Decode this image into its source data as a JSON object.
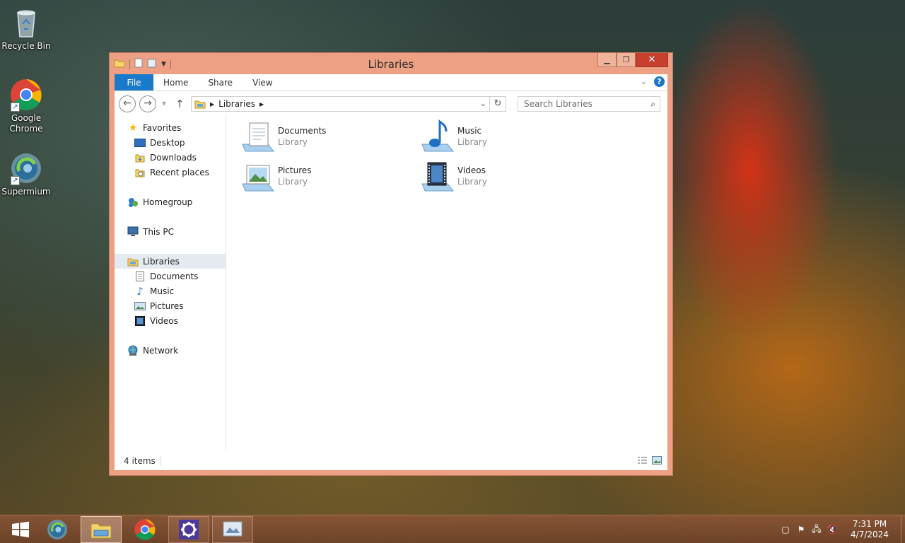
{
  "desktop": {
    "icons": [
      {
        "label": "Recycle Bin",
        "icon": "recycle-bin-icon"
      },
      {
        "label": "Google Chrome",
        "label_line1": "Google",
        "label_line2": "Chrome",
        "icon": "chrome-icon"
      },
      {
        "label": "Supermium",
        "icon": "supermium-icon"
      }
    ]
  },
  "window": {
    "title": "Libraries",
    "ribbon_tabs": [
      "File",
      "Home",
      "Share",
      "View"
    ],
    "help_label": "?",
    "address": {
      "segments": [
        "Libraries"
      ]
    },
    "search_placeholder": "Search Libraries",
    "nav_pane": {
      "favorites": {
        "label": "Favorites",
        "items": [
          "Desktop",
          "Downloads",
          "Recent places"
        ]
      },
      "homegroup": "Homegroup",
      "this_pc": "This PC",
      "libraries": {
        "label": "Libraries",
        "items": [
          "Documents",
          "Music",
          "Pictures",
          "Videos"
        ]
      },
      "network": "Network"
    },
    "content": {
      "items": [
        {
          "name": "Documents",
          "type": "Library",
          "icon": "documents-library-icon"
        },
        {
          "name": "Music",
          "type": "Library",
          "icon": "music-library-icon"
        },
        {
          "name": "Pictures",
          "type": "Library",
          "icon": "pictures-library-icon"
        },
        {
          "name": "Videos",
          "type": "Library",
          "icon": "videos-library-icon"
        }
      ]
    },
    "status": {
      "item_count": "4 items"
    }
  },
  "taskbar": {
    "apps": [
      "Start",
      "Supermium",
      "File Explorer",
      "Google Chrome",
      "Settings",
      "Photos"
    ],
    "clock": {
      "time": "7:31 PM",
      "date": "4/7/2024"
    }
  },
  "colors": {
    "window_frame": "#eda084",
    "file_tab": "#1979ca",
    "close_button": "#c7402f",
    "taskbar": "#8c5537"
  }
}
